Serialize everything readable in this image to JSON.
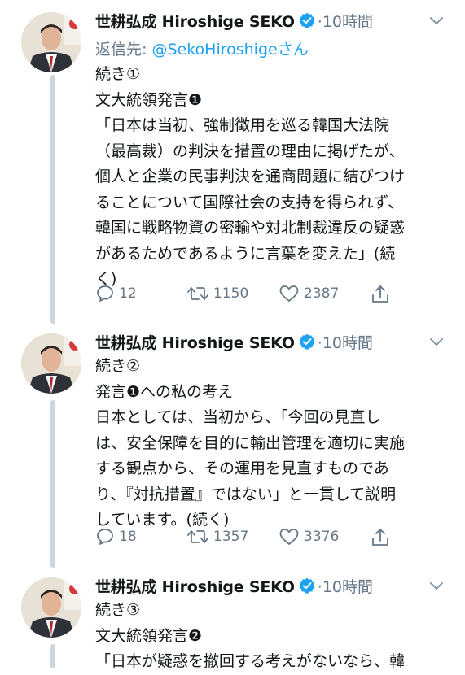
{
  "tweets": [
    {
      "author_name": "世耕弘成 Hiroshige SEKO",
      "time": "·10時間",
      "reply_prefix": "返信先: ",
      "reply_handle": "@SekoHiroshigeさん",
      "lines": [
        "続き①",
        "文大統領発言❶",
        "「日本は当初、強制徴用を巡る韓国大法院",
        "（最高裁）の判決を措置の理由に掲げたが、",
        "個人と企業の民事判決を通商問題に結びつけ",
        "ることについて国際社会の支持を得られず、",
        "韓国に戦略物資の密輸や対北制裁違反の疑惑",
        "があるためであるように言葉を変えた」(続",
        "く)"
      ],
      "replies": "12",
      "retweets": "1150",
      "likes": "2387"
    },
    {
      "author_name": "世耕弘成 Hiroshige SEKO",
      "time": "·10時間",
      "lines": [
        "続き②",
        "発言❶への私の考え",
        "日本としては、当初から、「今回の見直し",
        "は、安全保障を目的に輸出管理を適切に実施",
        "する観点から、その運用を見直すものであ",
        "り、『対抗措置』ではない」と一貫して説明",
        "しています。(続く)"
      ],
      "replies": "18",
      "retweets": "1357",
      "likes": "3376"
    },
    {
      "author_name": "世耕弘成 Hiroshige SEKO",
      "time": "·10時間",
      "lines": [
        "続き③",
        "文大統領発言❷",
        "「日本が疑惑を撤回する考えがないなら、韓"
      ]
    }
  ],
  "colors": {
    "accent": "#1da1f2",
    "muted": "#657786",
    "text": "#14171a",
    "thread_line": "#cdd5dd"
  },
  "icons": [
    "verified-badge-icon",
    "chevron-down-icon",
    "reply-icon",
    "retweet-icon",
    "like-icon",
    "share-icon"
  ]
}
